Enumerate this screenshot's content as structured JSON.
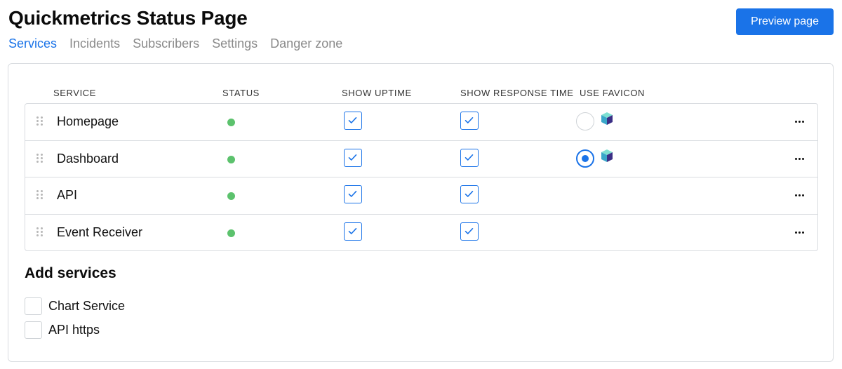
{
  "header": {
    "title": "Quickmetrics Status Page",
    "preview_label": "Preview page"
  },
  "tabs": [
    {
      "label": "Services",
      "active": true
    },
    {
      "label": "Incidents",
      "active": false
    },
    {
      "label": "Subscribers",
      "active": false
    },
    {
      "label": "Settings",
      "active": false
    },
    {
      "label": "Danger zone",
      "active": false
    }
  ],
  "table": {
    "columns": {
      "service": "SERVICE",
      "status": "STATUS",
      "show_uptime": "SHOW UPTIME",
      "show_response_time": "SHOW RESPONSE TIME",
      "use_favicon": "USE FAVICON"
    },
    "rows": [
      {
        "name": "Homepage",
        "status": "up",
        "show_uptime": true,
        "show_response_time": true,
        "favicon": "available",
        "use_favicon": false
      },
      {
        "name": "Dashboard",
        "status": "up",
        "show_uptime": true,
        "show_response_time": true,
        "favicon": "available",
        "use_favicon": true
      },
      {
        "name": "API",
        "status": "up",
        "show_uptime": true,
        "show_response_time": true,
        "favicon": "none",
        "use_favicon": false
      },
      {
        "name": "Event Receiver",
        "status": "up",
        "show_uptime": true,
        "show_response_time": true,
        "favicon": "none",
        "use_favicon": false
      }
    ]
  },
  "add_services": {
    "title": "Add services",
    "items": [
      {
        "label": "Chart Service",
        "checked": false
      },
      {
        "label": "API https",
        "checked": false
      }
    ]
  },
  "icons": {
    "drag": "drag-handle-icon",
    "check": "checkmark-icon",
    "favicon": "cube-favicon-icon",
    "more": "ellipsis-icon"
  },
  "colors": {
    "accent": "#1a73e8",
    "status_up": "#5cc26d",
    "tab_inactive": "#8a8a8a",
    "border": "#d9dce0"
  }
}
